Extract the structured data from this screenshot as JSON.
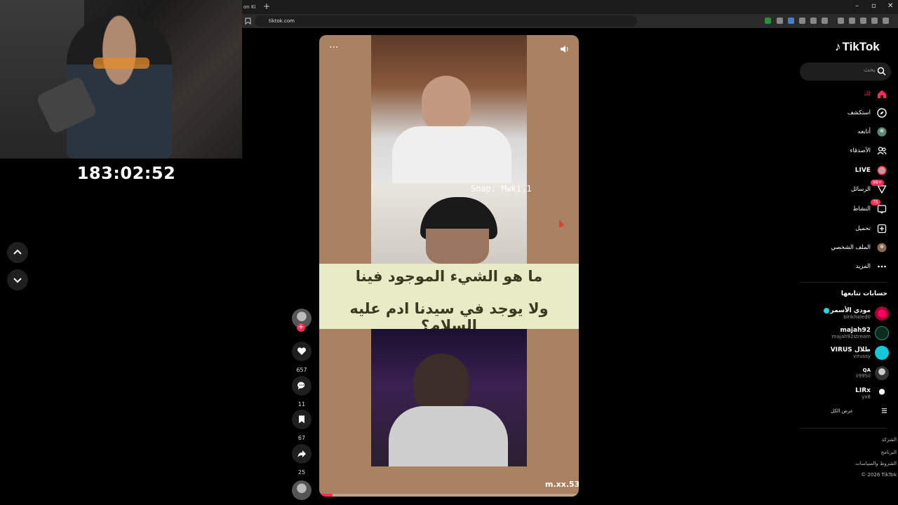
{
  "stream": {
    "timer": "183:02:52"
  },
  "browser": {
    "tab_title": "on Ki",
    "new_tab": "+",
    "url": "tiktok.com",
    "window_controls": [
      "–",
      "▫",
      "✕"
    ]
  },
  "video": {
    "snap_overlay": "Snap: Mwki.1",
    "caption_line1": "ما هو الشيء الموجود فينا",
    "caption_line2": "ولا يوجد في سيدنا ادم عليه السلام؟",
    "creator": "m.xx.53",
    "more_label": "···",
    "progress": 0.05,
    "progress_color": "#fe2c55"
  },
  "actions": {
    "likes": "657",
    "comments": "11",
    "saves": "67",
    "shares": "25"
  },
  "sidebar": {
    "brand": "TikTok",
    "search_placeholder": "بحث",
    "nav": [
      {
        "label": "لك",
        "icon": "home-icon",
        "active": true
      },
      {
        "label": "استكشف",
        "icon": "compass-icon"
      },
      {
        "label": "أتابعه",
        "icon": "following-avatar-icon"
      },
      {
        "label": "الأصدقاء",
        "icon": "friends-icon"
      },
      {
        "label": "LIVE",
        "icon": "live-icon"
      },
      {
        "label": "الرسائل",
        "icon": "messages-icon",
        "badge": "99+"
      },
      {
        "label": "النشاط",
        "icon": "activity-icon",
        "badge": "75"
      },
      {
        "label": "تحميل",
        "icon": "upload-icon"
      },
      {
        "label": "الملف الشخصي",
        "icon": "profile-avatar-icon"
      },
      {
        "label": "المزيد",
        "icon": "more-icon"
      }
    ],
    "following_title": "حسابات تتابعها",
    "accounts": [
      {
        "name": "مودي الأسمر",
        "username": "binkhaled0",
        "verified": true
      },
      {
        "name": "majah92",
        "username": "majah92stream"
      },
      {
        "name": "VIRUS طلال",
        "username": "virussy"
      },
      {
        "name": "QA",
        "username": "ii99Sil"
      },
      {
        "name": "LIRx",
        "username": "yx8"
      }
    ],
    "see_all": "عرض الكل",
    "footer": [
      "الشركة",
      "البرنامج",
      "الشروط والسياسات",
      "© 2026 TikTok"
    ],
    "accent": "#fe2c55"
  }
}
